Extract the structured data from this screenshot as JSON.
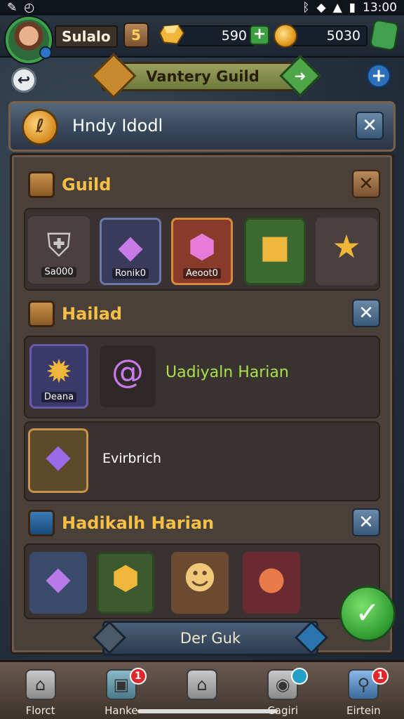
{
  "status_bar": {
    "time": "13:00"
  },
  "header": {
    "player_name": "Sulalo",
    "level": "5",
    "gems": "590",
    "coins": "5030"
  },
  "guild_banner": {
    "title": "Vantery Guild"
  },
  "panel": {
    "title": "Hndy Idodl"
  },
  "sections": [
    {
      "title": "Guild",
      "items": [
        {
          "label": "Sa000",
          "glyph": "⚙",
          "bg": "#4a4040"
        },
        {
          "label": "Ronik0",
          "glyph": "◆",
          "bg": "#3a3a5a"
        },
        {
          "label": "Aeoot0",
          "glyph": "⬢",
          "bg": "#8a3a2a"
        },
        {
          "label": "",
          "glyph": "■",
          "bg": "#3c6a30"
        },
        {
          "label": "",
          "glyph": "★",
          "bg": "#4a4040"
        }
      ]
    },
    {
      "title": "Hailad",
      "rows": [
        {
          "label": "Deana",
          "name": "Uadiyaln Harian"
        },
        {
          "label": "",
          "name": "Evirbrich"
        }
      ]
    },
    {
      "title": "Hadikalh Harian",
      "items": [
        {
          "label": "",
          "glyph": "◆",
          "bg": "#3a4a6a"
        },
        {
          "label": "",
          "glyph": "⬢",
          "bg": "#3c5a30"
        },
        {
          "label": "",
          "glyph": "☻",
          "bg": "#6a4a30"
        },
        {
          "label": "",
          "glyph": "●",
          "bg": "#6a2a30"
        }
      ]
    }
  ],
  "action_button": "Der Guk",
  "nav": [
    {
      "label": "Florct",
      "icon": "home-icon",
      "badge": ""
    },
    {
      "label": "Hanke",
      "icon": "cube-icon",
      "badge": "1"
    },
    {
      "label": "",
      "icon": "house-icon",
      "badge": ""
    },
    {
      "label": "Cagiri",
      "icon": "camera-icon",
      "badge": ""
    },
    {
      "label": "Eirtein",
      "icon": "search-icon",
      "badge": "1"
    }
  ]
}
